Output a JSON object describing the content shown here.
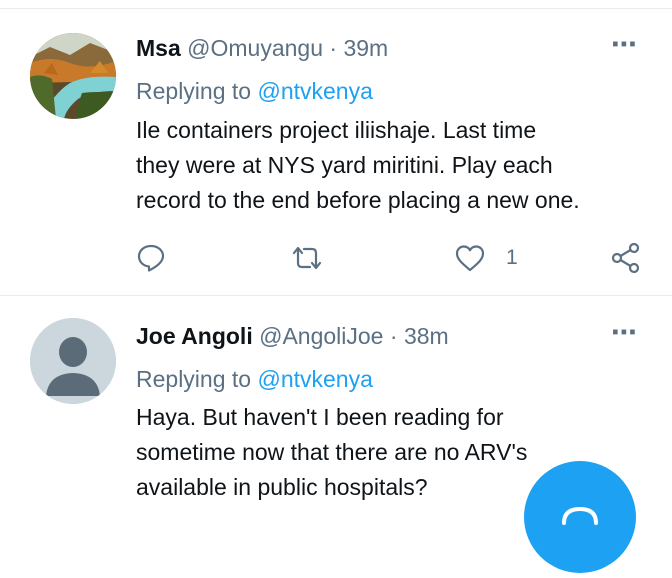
{
  "tweets": [
    {
      "name": "Msa",
      "handle": "@Omuyangu",
      "separator": "·",
      "time": "39m",
      "replying_prefix": "Replying to",
      "replying_to": "@ntvkenya",
      "lines": [
        "Ile containers project iliishaje. Last time",
        "they were at NYS yard miritini. Play each",
        "record to the end before placing a new one."
      ],
      "like_count": "1",
      "avatar_icon": "landscape-river-photo"
    },
    {
      "name": "Joe Angoli",
      "handle": "@AngoliJoe",
      "separator": "·",
      "time": "38m",
      "replying_prefix": "Replying to",
      "replying_to": "@ntvkenya",
      "lines": [
        "Haya. But haven't I been reading for",
        "sometime now that there are no ARV's",
        "available in public hospitals?"
      ],
      "avatar_icon": "default-profile-icon"
    }
  ],
  "more_icon": "⋯",
  "colors": {
    "accent": "#1da1f2",
    "secondary_text": "#5b7083",
    "primary_text": "#0f1419",
    "divider": "#e6ecf0",
    "default_avatar_bg": "#ccd6dd"
  },
  "fab_icon": "compose-icon"
}
